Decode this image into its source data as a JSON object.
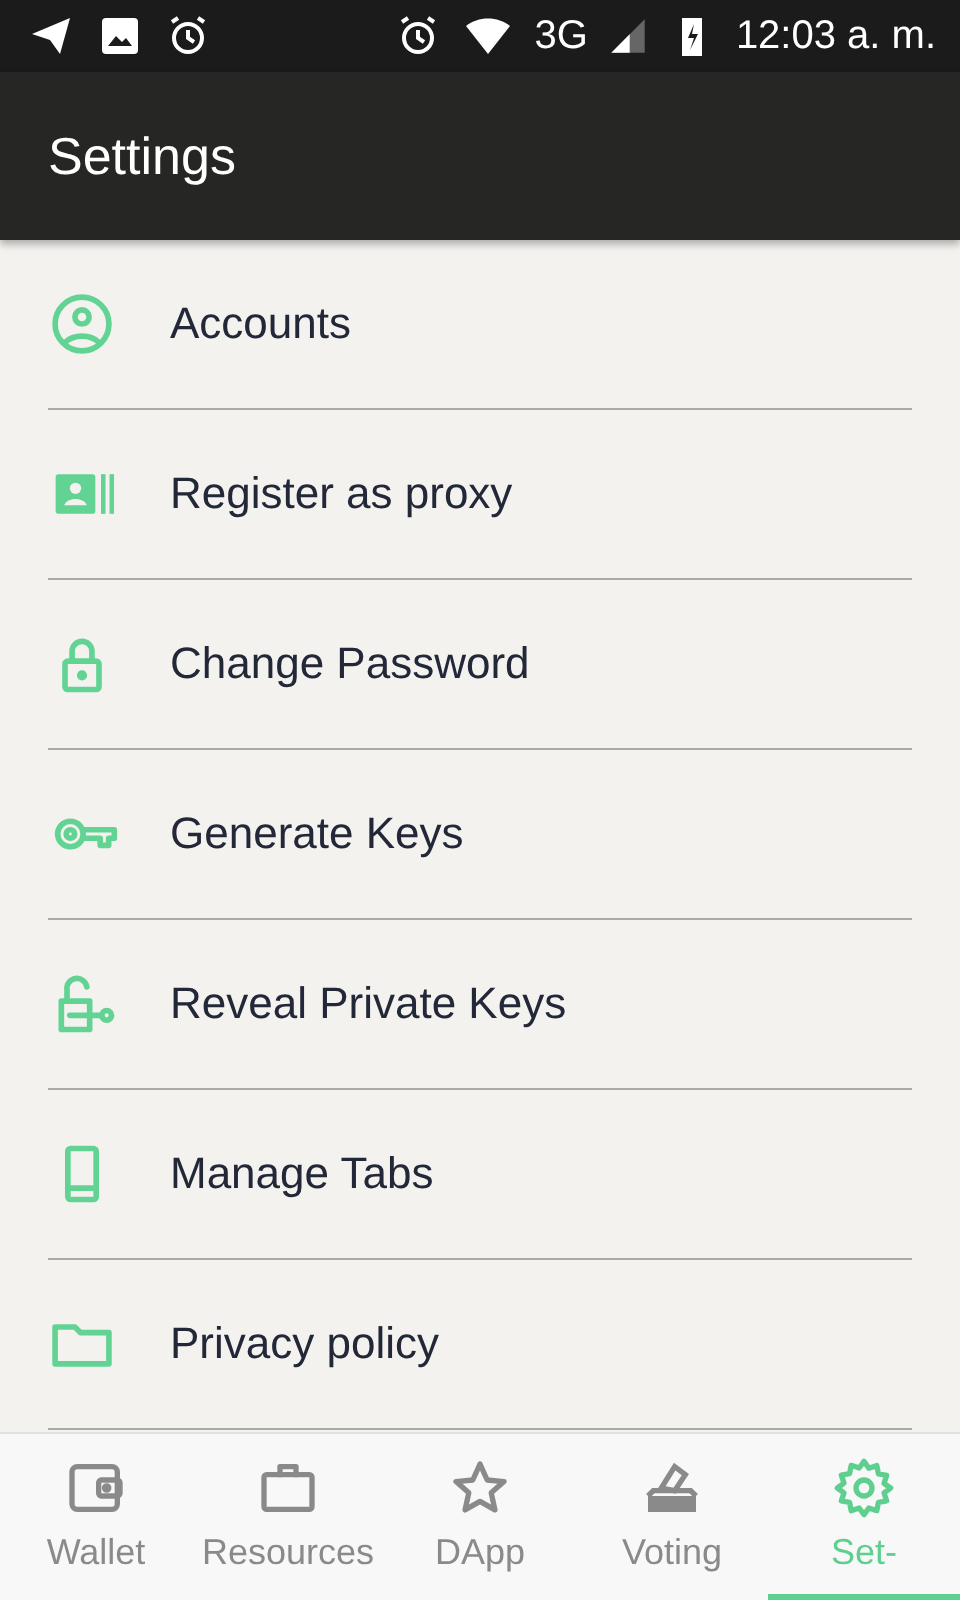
{
  "status_bar": {
    "network": "3G",
    "time": "12:03 a. m."
  },
  "header": {
    "title": "Settings"
  },
  "settings_items": [
    {
      "kind": "account",
      "label": "Accounts"
    },
    {
      "kind": "proxy",
      "label": "Register as proxy"
    },
    {
      "kind": "lock",
      "label": "Change Password"
    },
    {
      "kind": "key",
      "label": "Generate Keys"
    },
    {
      "kind": "unlock",
      "label": "Reveal Private Keys"
    },
    {
      "kind": "tablet",
      "label": "Manage Tabs"
    },
    {
      "kind": "folder",
      "label": "Privacy policy"
    }
  ],
  "bottom_nav": [
    {
      "kind": "wallet",
      "label": "Wallet",
      "selected": false
    },
    {
      "kind": "briefcase",
      "label": "Resources",
      "selected": false
    },
    {
      "kind": "star",
      "label": "DApp",
      "selected": false
    },
    {
      "kind": "vote",
      "label": "Voting",
      "selected": false
    },
    {
      "kind": "gear",
      "label": "Set-",
      "selected": true
    }
  ]
}
